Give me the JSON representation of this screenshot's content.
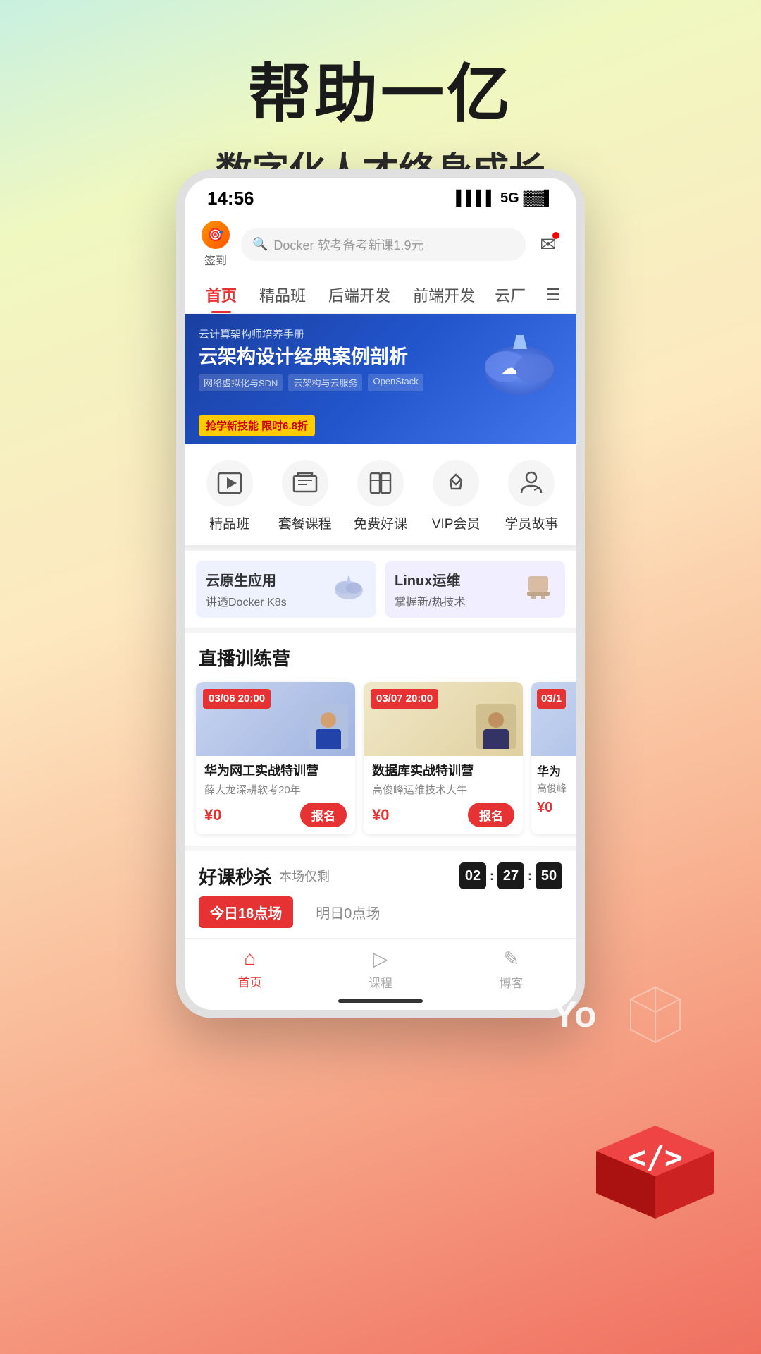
{
  "background": {
    "gradient": "linear-gradient(160deg, #c8f0e0 0%, #f0f8c0 15%, #fde8c0 40%, #f8b090 70%, #f07060 100%)"
  },
  "hero": {
    "title": "帮助一亿",
    "subtitle": "数字化人才终身成长"
  },
  "status_bar": {
    "time": "14:56",
    "signal": "▌▌▌▌",
    "network": "5G",
    "battery": "🔋"
  },
  "header": {
    "sign_label": "签到",
    "search_placeholder": "Docker 软考备考新课1.9元"
  },
  "nav_tabs": [
    {
      "label": "首页",
      "active": true
    },
    {
      "label": "精品班",
      "active": false
    },
    {
      "label": "后端开发",
      "active": false
    },
    {
      "label": "前端开发",
      "active": false
    },
    {
      "label": "云厂",
      "active": false
    }
  ],
  "banner": {
    "small_label": "云计算架构师培养手册",
    "title": "云架构设计经典案例剖析",
    "tags": [
      "网络虚拟化与SDN",
      "云架构与云服务",
      "OpenStack"
    ],
    "promo": "抢学新技能 限时6.8折"
  },
  "quick_links": [
    {
      "label": "精品班",
      "icon": "▶"
    },
    {
      "label": "套餐课程",
      "icon": "📁"
    },
    {
      "label": "免费好课",
      "icon": "📖"
    },
    {
      "label": "VIP会员",
      "icon": "◇"
    },
    {
      "label": "学员故事",
      "icon": "👤"
    }
  ],
  "course_row": [
    {
      "title": "云原生应用",
      "subtitle": "讲透Docker K8s",
      "icon": "☁"
    },
    {
      "title": "Linux运维",
      "subtitle": "掌握新/热技术",
      "icon": "📦"
    }
  ],
  "live_section": {
    "title": "直播训练营",
    "cards": [
      {
        "date": "03/06 20:00",
        "course_title": "华为网工实战特训营",
        "author": "薛大龙深耕软考20年",
        "price": "¥0",
        "has_signup": true
      },
      {
        "date": "03/07 20:00",
        "course_title": "数据库实战特训营",
        "author": "高俊峰运维技术大牛",
        "price": "¥0",
        "has_signup": true
      },
      {
        "date": "03/1",
        "course_title": "华为",
        "author": "高俊峰",
        "price": "¥0",
        "has_signup": false
      }
    ]
  },
  "flash_sale": {
    "title": "好课秒杀",
    "subtitle": "本场仅剩",
    "timer": {
      "h": "02",
      "m": "27",
      "s": "50"
    },
    "tabs": [
      {
        "label": "今日18点场",
        "active": true
      },
      {
        "label": "明日0点场",
        "active": false
      }
    ]
  },
  "bottom_nav": [
    {
      "label": "首页",
      "icon": "⌂",
      "active": true
    },
    {
      "label": "课程",
      "icon": "▷",
      "active": false
    },
    {
      "label": "博客",
      "icon": "✎",
      "active": false
    }
  ],
  "code_cube_icon": "</>",
  "yo_label": "Yo"
}
